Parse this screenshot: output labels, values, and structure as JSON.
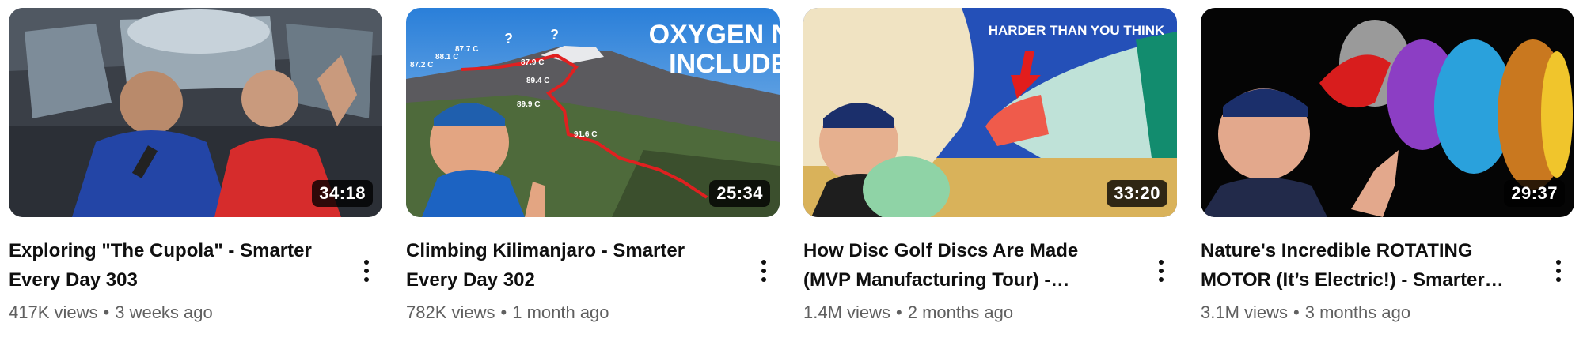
{
  "videos": [
    {
      "title": "Exploring \"The Cupola\" - Smarter Every Day 303",
      "views": "417K views",
      "age": "3 weeks ago",
      "duration": "34:18",
      "thumb_text": []
    },
    {
      "title": "Climbing Kilimanjaro - Smarter Every Day 302",
      "views": "782K views",
      "age": "1 month ago",
      "duration": "25:34",
      "thumb_text": [
        "OXYGEN NOT",
        "INCLUDED",
        "87.2 C",
        "88.1 C",
        "87.7 C",
        "87.9 C",
        "89.4 C",
        "89.9 C",
        "91.6 C",
        "?",
        "?"
      ]
    },
    {
      "title": "How Disc Golf Discs Are Made (MVP Manufacturing Tour) - Smarter Every Day",
      "views": "1.4M views",
      "age": "2 months ago",
      "duration": "33:20",
      "thumb_text": [
        "HARDER THAN YOU THINK"
      ]
    },
    {
      "title": "Nature's Incredible ROTATING MOTOR (It’s Electric!) - Smarter Every Day",
      "views": "3.1M views",
      "age": "3 months ago",
      "duration": "29:37",
      "thumb_text": []
    }
  ],
  "separator": "•",
  "icons": {
    "more": "more-vert-icon"
  }
}
